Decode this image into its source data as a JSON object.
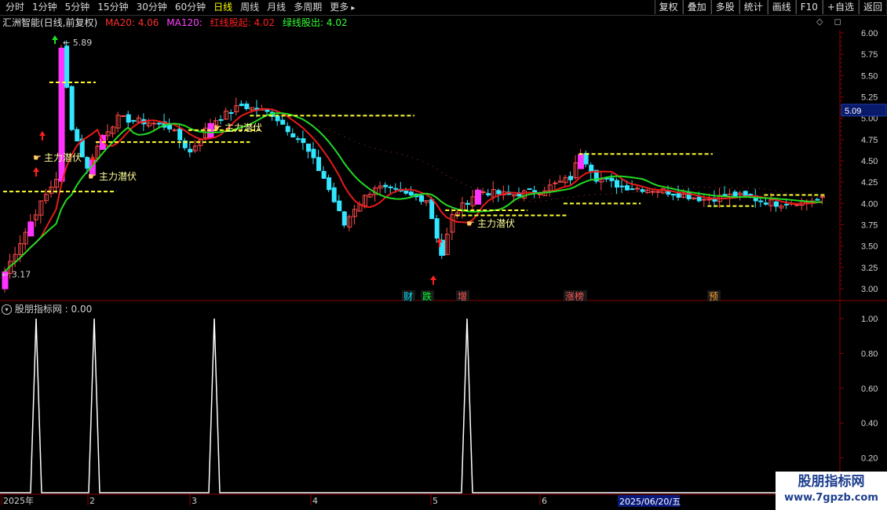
{
  "toolbar": {
    "periods": [
      {
        "label": "分时",
        "active": false
      },
      {
        "label": "1分钟",
        "active": false
      },
      {
        "label": "5分钟",
        "active": false
      },
      {
        "label": "15分钟",
        "active": false
      },
      {
        "label": "30分钟",
        "active": false
      },
      {
        "label": "60分钟",
        "active": false
      },
      {
        "label": "日线",
        "active": true
      },
      {
        "label": "周线",
        "active": false
      },
      {
        "label": "月线",
        "active": false
      },
      {
        "label": "多周期",
        "active": false
      },
      {
        "label": "更多",
        "active": false
      }
    ],
    "buttons": [
      "复权",
      "叠加",
      "多股",
      "统计",
      "画线",
      "F10",
      "+自选",
      "返回"
    ]
  },
  "info": {
    "stock": "汇洲智能(日线,前复权)",
    "ma20": "MA20: 4.06",
    "ma120": "MA120:",
    "red_line": "红线股起: 4.02",
    "green_line": "绿线股出: 4.02"
  },
  "main_axis": {
    "ticks": [
      "6.00",
      "5.75",
      "5.50",
      "5.25",
      "5.00",
      "4.75",
      "4.50",
      "4.25",
      "4.00",
      "3.75",
      "3.50",
      "3.25",
      "3.00"
    ],
    "current_price": "5.09"
  },
  "annotations": {
    "high": "5.89",
    "low": "3.17",
    "signal_label": "主力潜伏",
    "events": [
      {
        "label": "财",
        "color": "#00e5ff"
      },
      {
        "label": "跌",
        "color": "#00ff33"
      },
      {
        "label": "增",
        "color": "#ff5555"
      },
      {
        "label": "涨榜",
        "color": "#ff5555"
      },
      {
        "label": "预",
        "color": "#ffa030"
      }
    ]
  },
  "indicator": {
    "title": "股朋指标网 : 0.00",
    "ticks": [
      "1.00",
      "0.80",
      "0.60",
      "0.40",
      "0.20"
    ]
  },
  "date_axis": {
    "labels": [
      "2025年",
      "2",
      "3",
      "4",
      "5",
      "6"
    ],
    "cursor_date": "2025/06/20/五"
  },
  "watermark": {
    "line1": "股朋指标网",
    "line2": "www.7gpzb.com"
  },
  "colors": {
    "up": "#ff33ff",
    "down": "#33e6ff",
    "ma_red": "#e81a1a",
    "ma_green": "#22d822",
    "dash": "#ffff33",
    "grid": "#8b0000"
  }
}
